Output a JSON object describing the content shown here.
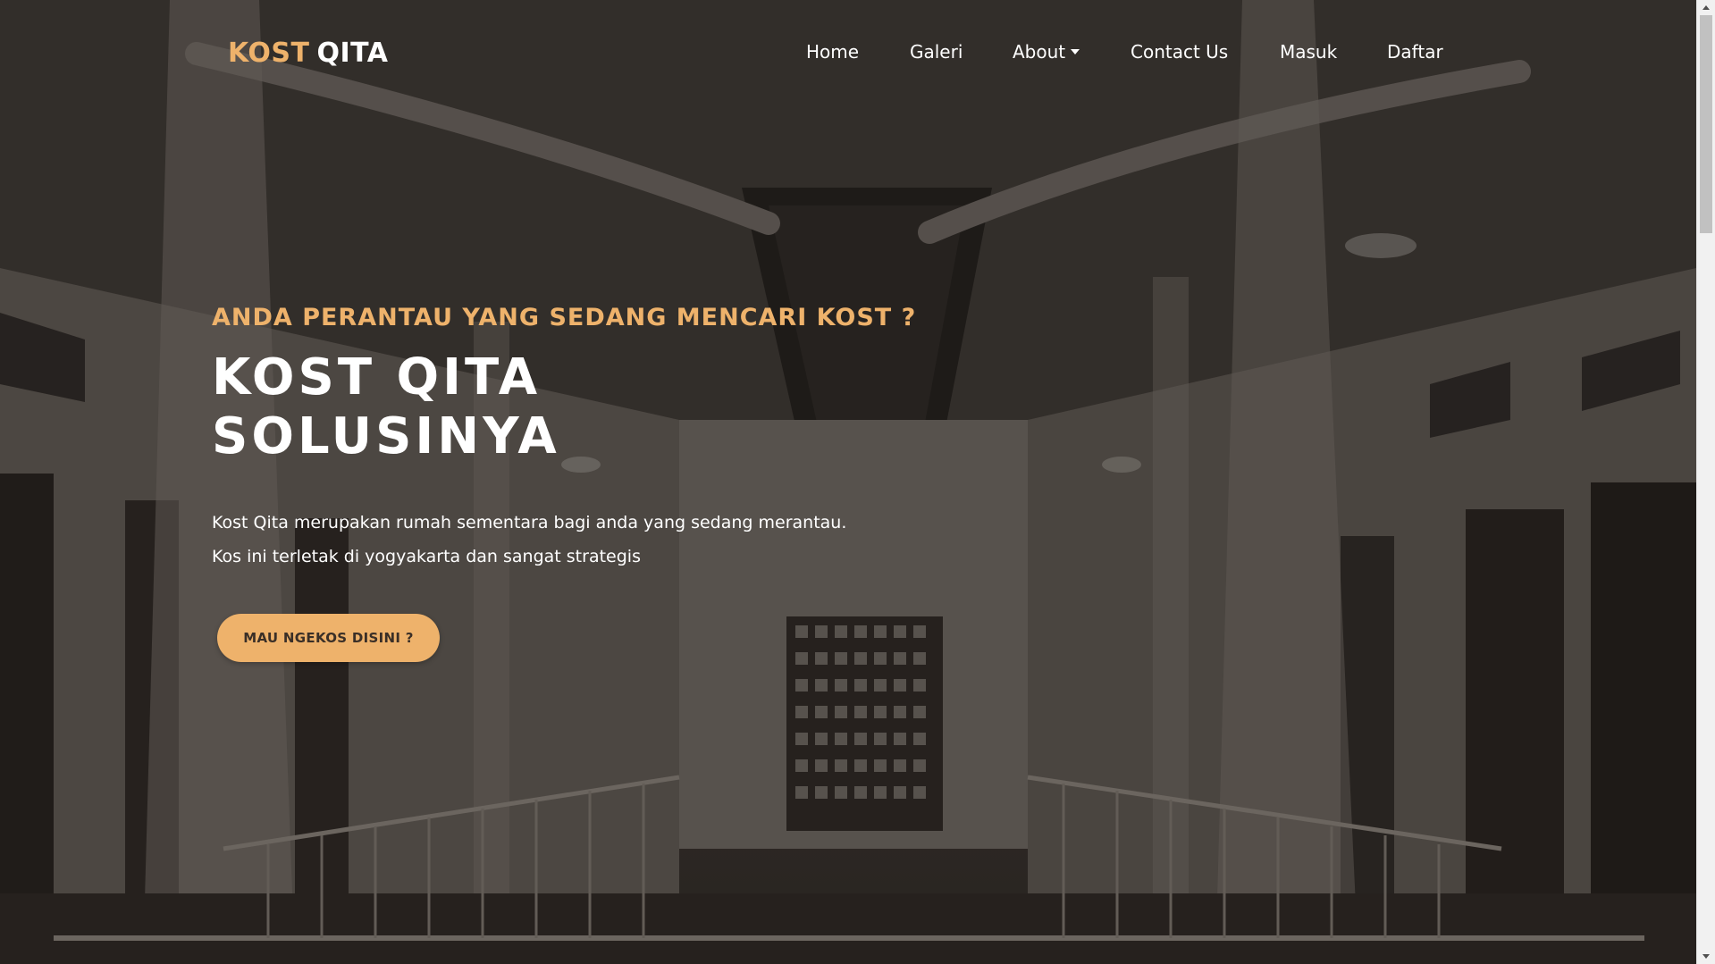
{
  "navbar": {
    "brand_accent": "KOST",
    "brand_main": "QITA",
    "links": [
      {
        "label": "Home"
      },
      {
        "label": "Galeri"
      },
      {
        "label": "About",
        "has_dropdown": true
      },
      {
        "label": "Contact Us"
      },
      {
        "label": "Masuk"
      },
      {
        "label": "Daftar"
      }
    ]
  },
  "hero": {
    "kicker": "ANDA PERANTAU YANG SEDANG MENCARI KOST ?",
    "title_line1": "KOST QITA",
    "title_line2": "SOLUSINYA",
    "desc_line1": "Kost Qita merupakan rumah sementara bagi anda yang sedang merantau.",
    "desc_line2": "Kos ini terletak di yogyakarta dan sangat strategis",
    "cta_label": "MAU NGEKOS DISINI ?"
  },
  "colors": {
    "accent": "#eeb26b",
    "text_light": "#ffffff",
    "background_dark": "#2b2521"
  },
  "icons": {
    "dropdown": "caret-down-icon",
    "scroll_up": "scroll-up-arrow-icon",
    "scroll_down": "scroll-down-arrow-icon"
  }
}
